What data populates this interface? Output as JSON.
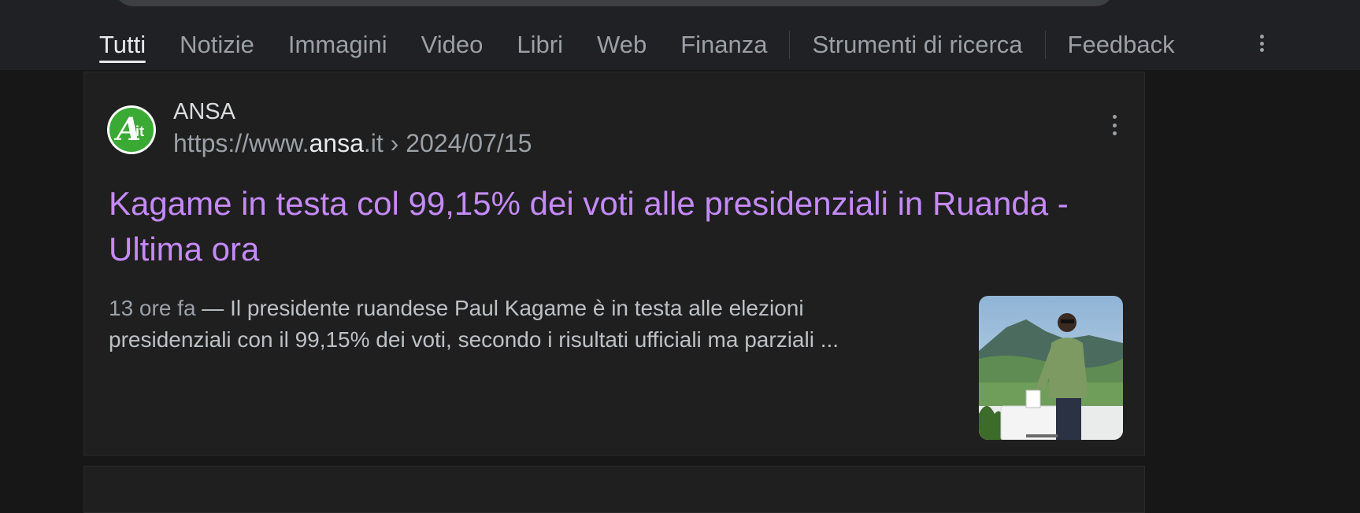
{
  "tabs": [
    {
      "label": "Tutti",
      "active": true
    },
    {
      "label": "Notizie"
    },
    {
      "label": "Immagini"
    },
    {
      "label": "Video"
    },
    {
      "label": "Libri"
    },
    {
      "label": "Web"
    },
    {
      "label": "Finanza"
    }
  ],
  "tools_label": "Strumenti di ricerca",
  "feedback_label": "Feedback",
  "result": {
    "site_name": "ANSA",
    "url_prefix": "https://www.",
    "url_domain": "ansa",
    "url_suffix": ".it › 2024/07/15",
    "favicon_text": "A",
    "favicon_sub": "it",
    "title": "Kagame in testa col 99,15% dei voti alle presidenziali in Ruanda - Ultima ora",
    "date": "13 ore fa",
    "separator": " — ",
    "snippet": "Il presidente ruandese Paul Kagame è in testa alle elezioni presidenziali con il 99,15% dei voti, secondo i risultati ufficiali ma parziali ..."
  },
  "colors": {
    "background": "#171717",
    "link_visited": "#c58af9",
    "text_muted": "#9aa0a6",
    "favicon_green": "#3aaa35"
  }
}
